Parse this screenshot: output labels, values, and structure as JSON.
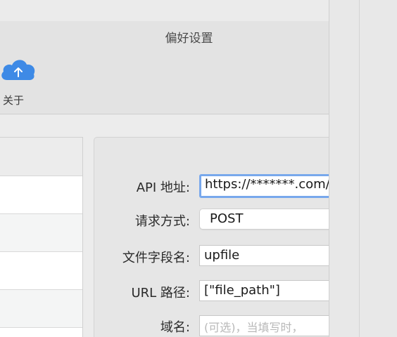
{
  "window": {
    "title": "偏好设置"
  },
  "toolbar": {
    "about_label": "关于"
  },
  "form": {
    "api_label": "API 地址:",
    "api_value": "https://*******.com/",
    "method_label": "请求方式:",
    "method_value": "POST",
    "filefield_label": "文件字段名:",
    "filefield_value": "upfile",
    "urlpath_label": "URL 路径:",
    "urlpath_value": "[\"file_path\"]",
    "domain_label": "域名:",
    "domain_placeholder": "(可选)，当填写时，"
  },
  "icons": {
    "about": "cloud-upload-icon"
  },
  "colors": {
    "accent": "#3e8ae6",
    "focus_ring": "#78a8ec"
  }
}
